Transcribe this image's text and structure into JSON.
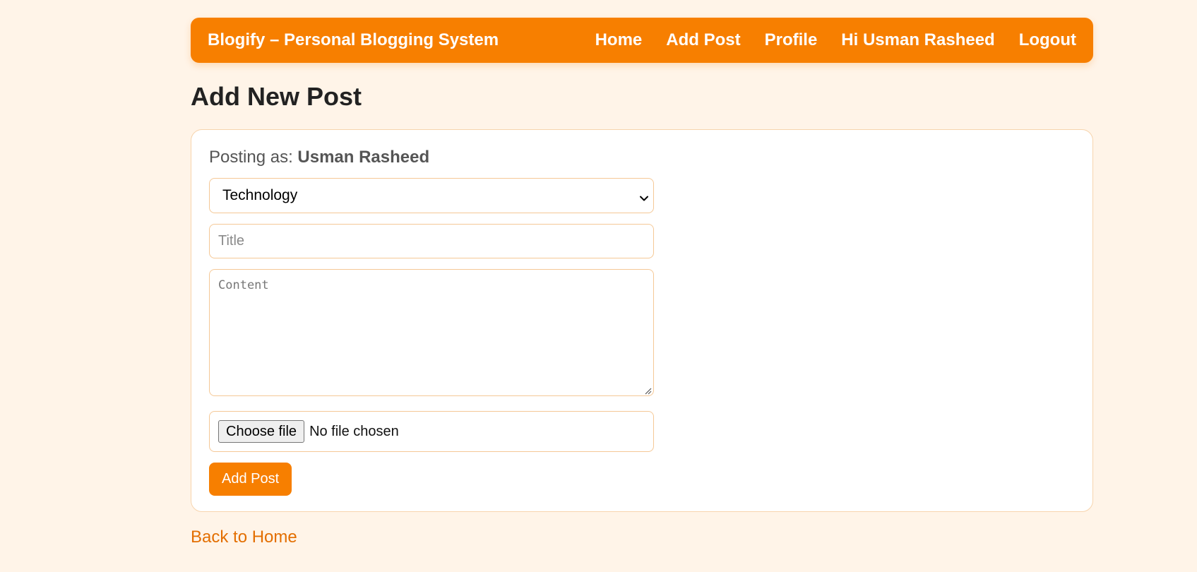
{
  "navbar": {
    "brand": "Blogify – Personal Blogging System",
    "links": {
      "home": "Home",
      "add_post": "Add Post",
      "profile": "Profile",
      "greeting": "Hi Usman Rasheed",
      "logout": "Logout"
    },
    "color": "#f77f00"
  },
  "page": {
    "title": "Add New Post"
  },
  "form": {
    "posting_as_label": "Posting as:",
    "posting_as_user": "Usman Rasheed",
    "category": {
      "selected": "Technology"
    },
    "title_placeholder": "Title",
    "content_placeholder": "Content",
    "file": {
      "button_label": "Choose file",
      "status": "No file chosen"
    },
    "submit_label": "Add Post"
  },
  "footer": {
    "back_link": "Back to Home"
  },
  "colors": {
    "background": "#fff4e8",
    "accent": "#f77f00",
    "link": "#e36e00",
    "field_border": "#f5c896"
  },
  "icons": {
    "select": "chevron-down-icon",
    "textarea": "resize-grip-icon"
  }
}
